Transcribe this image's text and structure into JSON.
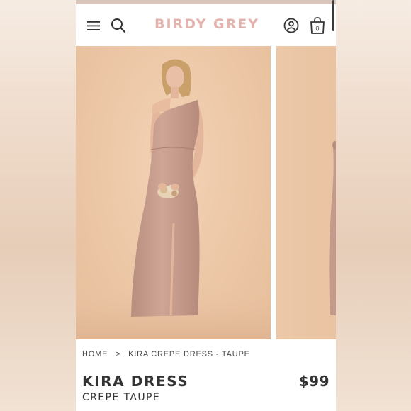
{
  "header": {
    "logo_text": "BIRDY GREY",
    "icons": {
      "menu": "hamburger-menu-icon",
      "search": "search-icon",
      "account": "account-icon",
      "cart": "shopping-bag-icon"
    },
    "cart_count": "0"
  },
  "gallery": {
    "main_image_alt": "model-wearing-one-shoulder-gown",
    "next_image_alt": "gown-side-view"
  },
  "breadcrumb": {
    "home": "HOME",
    "separator": ">",
    "current": "KIRA CREPE DRESS - TAUPE"
  },
  "product": {
    "name": "KIRA DRESS",
    "variant": "CREPE TAUPE",
    "price": "$99"
  },
  "colors": {
    "logo": "#e4b3ad",
    "dress": "#c9a090",
    "background": "#ecc7a6"
  }
}
